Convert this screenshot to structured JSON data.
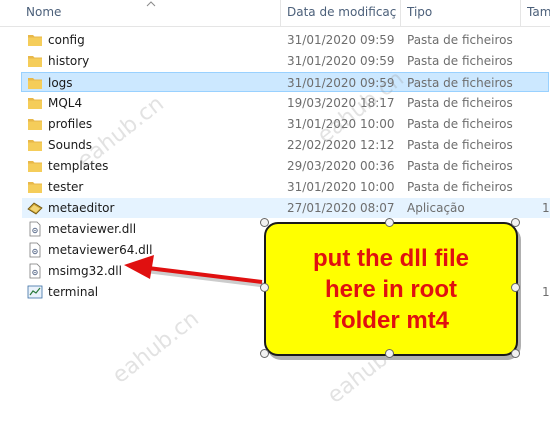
{
  "columns": {
    "name": "Nome",
    "date": "Data de modificaç…",
    "type": "Tipo",
    "size": "Tam"
  },
  "files": [
    {
      "name": "config",
      "date": "31/01/2020 09:59",
      "type": "Pasta de ficheiros",
      "size": "",
      "icon": "folder-icon"
    },
    {
      "name": "history",
      "date": "31/01/2020 09:59",
      "type": "Pasta de ficheiros",
      "size": "",
      "icon": "folder-icon"
    },
    {
      "name": "logs",
      "date": "31/01/2020 09:59",
      "type": "Pasta de ficheiros",
      "size": "",
      "icon": "folder-icon"
    },
    {
      "name": "MQL4",
      "date": "19/03/2020 18:17",
      "type": "Pasta de ficheiros",
      "size": "",
      "icon": "folder-icon"
    },
    {
      "name": "profiles",
      "date": "31/01/2020 10:00",
      "type": "Pasta de ficheiros",
      "size": "",
      "icon": "folder-icon"
    },
    {
      "name": "Sounds",
      "date": "22/02/2020 12:12",
      "type": "Pasta de ficheiros",
      "size": "",
      "icon": "folder-icon"
    },
    {
      "name": "templates",
      "date": "29/03/2020 00:36",
      "type": "Pasta de ficheiros",
      "size": "",
      "icon": "folder-icon"
    },
    {
      "name": "tester",
      "date": "31/01/2020 10:00",
      "type": "Pasta de ficheiros",
      "size": "",
      "icon": "folder-icon"
    },
    {
      "name": "metaeditor",
      "date": "27/01/2020 08:07",
      "type": "Aplicação",
      "size": "1",
      "icon": "metaeditor-icon"
    },
    {
      "name": "metaviewer.dll",
      "date": "",
      "type": "",
      "size": "",
      "icon": "dll-file-icon"
    },
    {
      "name": "metaviewer64.dll",
      "date": "",
      "type": "",
      "size": "",
      "icon": "dll-file-icon"
    },
    {
      "name": "msimg32.dll",
      "date": "",
      "type": "",
      "size": "",
      "icon": "dll-file-icon"
    },
    {
      "name": "terminal",
      "date": "",
      "type": "",
      "size": "1",
      "icon": "terminal-icon"
    }
  ],
  "callout": {
    "text": "put the dll file\nhere in root\nfolder mt4",
    "bg_color": "#ffff00",
    "text_color": "#e01010"
  },
  "watermark": "eahub.cn",
  "colors": {
    "selected_row": "#cce8ff",
    "hover_row": "#e5f3ff",
    "folder": "#e8b84a",
    "arrow": "#e01010"
  }
}
